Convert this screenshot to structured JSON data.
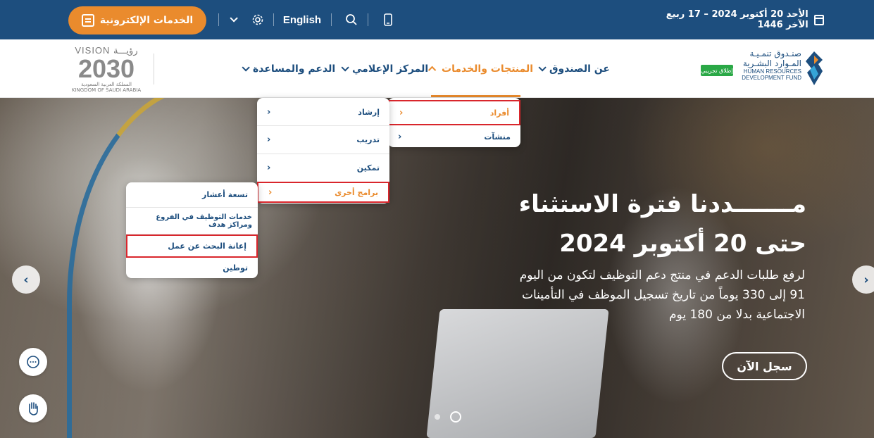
{
  "topbar": {
    "eservices_label": "الخدمات الإلكترونية",
    "language_label": "English",
    "date_text": "الأحد 20 أكتوبر 2024 – 17 ربيع الآخر 1446"
  },
  "header": {
    "vision": {
      "title": "VISION رؤيـــة",
      "year": "2030",
      "ar_caption": "المملكة العربية السعودية",
      "en_caption": "KINGDOM OF SAUDI ARABIA"
    },
    "hrdf": {
      "ar_line1": "صنـدوق تنمـيـة",
      "ar_line2": "المـوارد البشـرية",
      "en_line1": "HUMAN RESOURCES",
      "en_line2": "DEVELOPMENT FUND",
      "badge": "إطلاق تجريبي"
    },
    "nav": {
      "about": "عن الصندوق",
      "products": "المنتجات والخدمات",
      "media": "المركز الإعلامي",
      "support": "الدعم والمساعدة"
    }
  },
  "menus": {
    "level1": [
      "أفراد",
      "منشآت"
    ],
    "level2": [
      "إرشاد",
      "تدريب",
      "تمكين",
      "برامج أخرى"
    ],
    "level3": [
      "تسعة أعشار",
      "خدمات التوظيف في الفروع ومراكز هدف",
      "إعانة البحث عن عمل",
      "توطين"
    ]
  },
  "hero": {
    "title_line1": "مـــــــددنا فترة الاستثناء",
    "title_line2": "حتى 20 أكتوبر 2024",
    "description": "لرفع طلبات الدعم في منتج دعم التوظيف لتكون من اليوم 91 إلى 330 يوماً من تاريخ تسجيل الموظف في التأمينات الاجتماعية بدلا من 180 يوم",
    "cta": "سجل الآن"
  },
  "colors": {
    "primary": "#1d4e7e",
    "accent": "#ea8b2d",
    "highlight": "#d9262c",
    "badge": "#2aa846"
  }
}
